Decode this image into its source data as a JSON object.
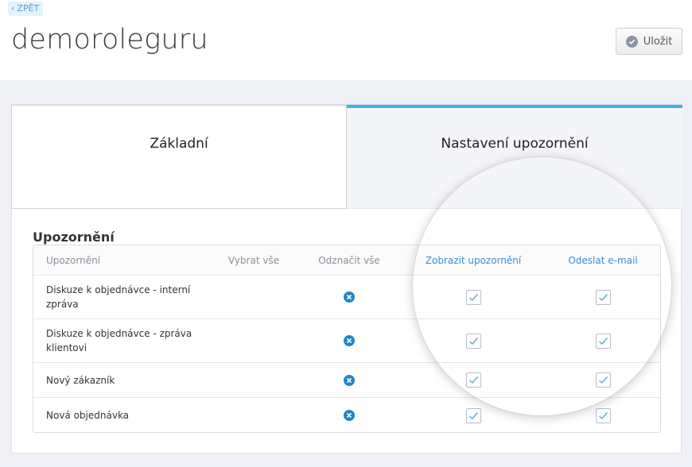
{
  "header": {
    "back_label": "ZPĚT",
    "title": "demoroleguru",
    "save_label": "Uložit"
  },
  "tabs": [
    {
      "label": "Základní",
      "active": false
    },
    {
      "label": "Nastavení upozornění",
      "active": true
    }
  ],
  "section": {
    "title": "Upozornění"
  },
  "table": {
    "columns": [
      "Upozornění",
      "Vybrat vše",
      "Odznačit vše",
      "Zobrazit upozornění",
      "Odeslat e-mail"
    ],
    "rows": [
      {
        "label": "Diskuze k objednávce - interní zpráva",
        "show": true,
        "email": true
      },
      {
        "label": "Diskuze k objednávce - zpráva klientovi",
        "show": true,
        "email": true
      },
      {
        "label": "Nový zákazník",
        "show": true,
        "email": true
      },
      {
        "label": "Nová objednávka",
        "show": true,
        "email": true
      }
    ]
  },
  "colors": {
    "accent": "#3fb1e4",
    "link": "#3a8fce",
    "clear_icon": "#2187c8"
  },
  "icons": {
    "back": "chevron-left-icon",
    "save": "check-circle-icon",
    "clear": "x-circle-icon",
    "checkbox": "checkmark-icon"
  }
}
